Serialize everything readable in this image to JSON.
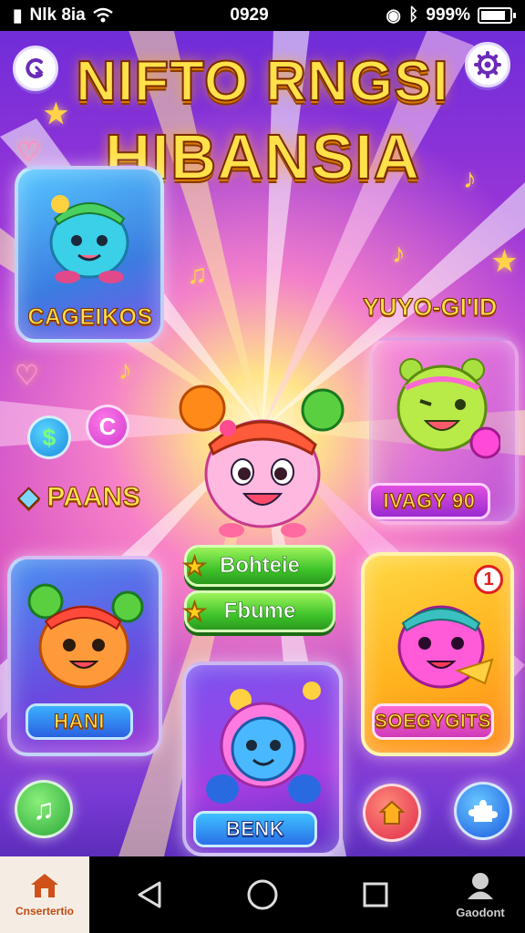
{
  "status_bar": {
    "carrier": "Nlk 8ia",
    "time": "0929",
    "battery": "999%"
  },
  "header": {
    "title_line1": "NIFTO RNGSI",
    "title_line2": "HIBANSIA",
    "back_icon": "refresh-back-icon",
    "settings_icon": "gear-icon"
  },
  "cards": {
    "top_left_label": "CAGEIKOS",
    "right_top_label": "YUYO-GI'ID",
    "right_pill": "IVAGY 90",
    "left_mid_label": "PAANS",
    "bottom_left_pill": "HANI",
    "bottom_center_pill": "BENK",
    "bottom_right_pill": "SOEGYGITS",
    "badge_count": "1"
  },
  "menu": {
    "button1": "Bohteie",
    "button2": "Fbume"
  },
  "coins": {
    "dollar": "$",
    "c": "C"
  },
  "nav": {
    "home_label": "Cnsertertio",
    "account_label": "Gaodont"
  },
  "colors": {
    "title": "#ffe14a",
    "button_green": "#3fc42a",
    "accent_purple": "#b03bd8"
  }
}
